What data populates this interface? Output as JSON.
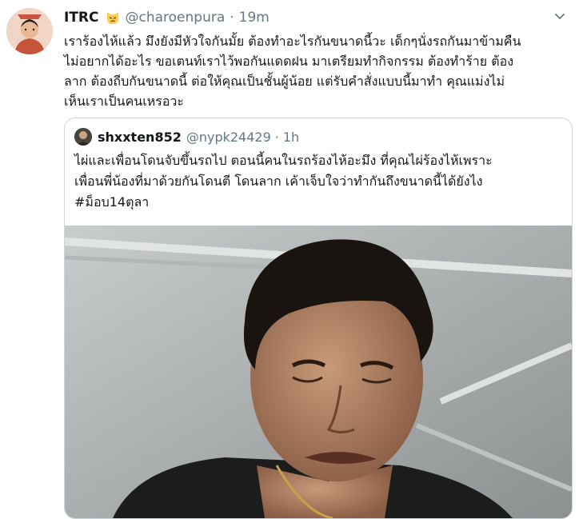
{
  "tweet": {
    "author_name": "ITRC",
    "author_handle": "@charoenpura",
    "separator": "·",
    "time": "19m",
    "emoji_icon": "pouting-cat-emoji",
    "text": "เราร้องไห้แล้ว มึงยังมีหัวใจกันมั้ย ต้องทำอะไรกันขนาดนี้วะ เด็กๆนั่งรถกันมาข้ามคืน\nไม่อยากได้อะไร ขอเตนท์เราไว้พอกันแดดฝน มาเตรียมทำกิจกรรม ต้องทำร้าย ต้อง\nลาก ต้องถีบกันขนาดนี้ ต่อให้คุณเป็นชั้นผู้น้อย แต่รับคำสั่งแบบนี้มาทำ คุณแม่งไม่\nเห็นเราเป็นคนเหรอวะ"
  },
  "quoted_tweet": {
    "author_name": "shxxten852",
    "author_handle": "@nypk24429",
    "separator": "·",
    "time": "1h",
    "text": "ไผ่และเพื่อนโดนจับขึ้นรถไป ตอนนี้คนในรถร้องไห้อะมึง  ที่คุณไผ่ร้องไห้เพราะ\nเพื่อนพี่น้องที่มาด้วยกันโดนตี โดนลาก เค้าเจ็บใจว่าทำกันถึงขนาดนี้ได้ยังไง\n#ม็อบ14ตุลา"
  },
  "colors": {
    "text_primary": "#14171a",
    "text_secondary": "#657786",
    "border": "#ccd6dd"
  }
}
